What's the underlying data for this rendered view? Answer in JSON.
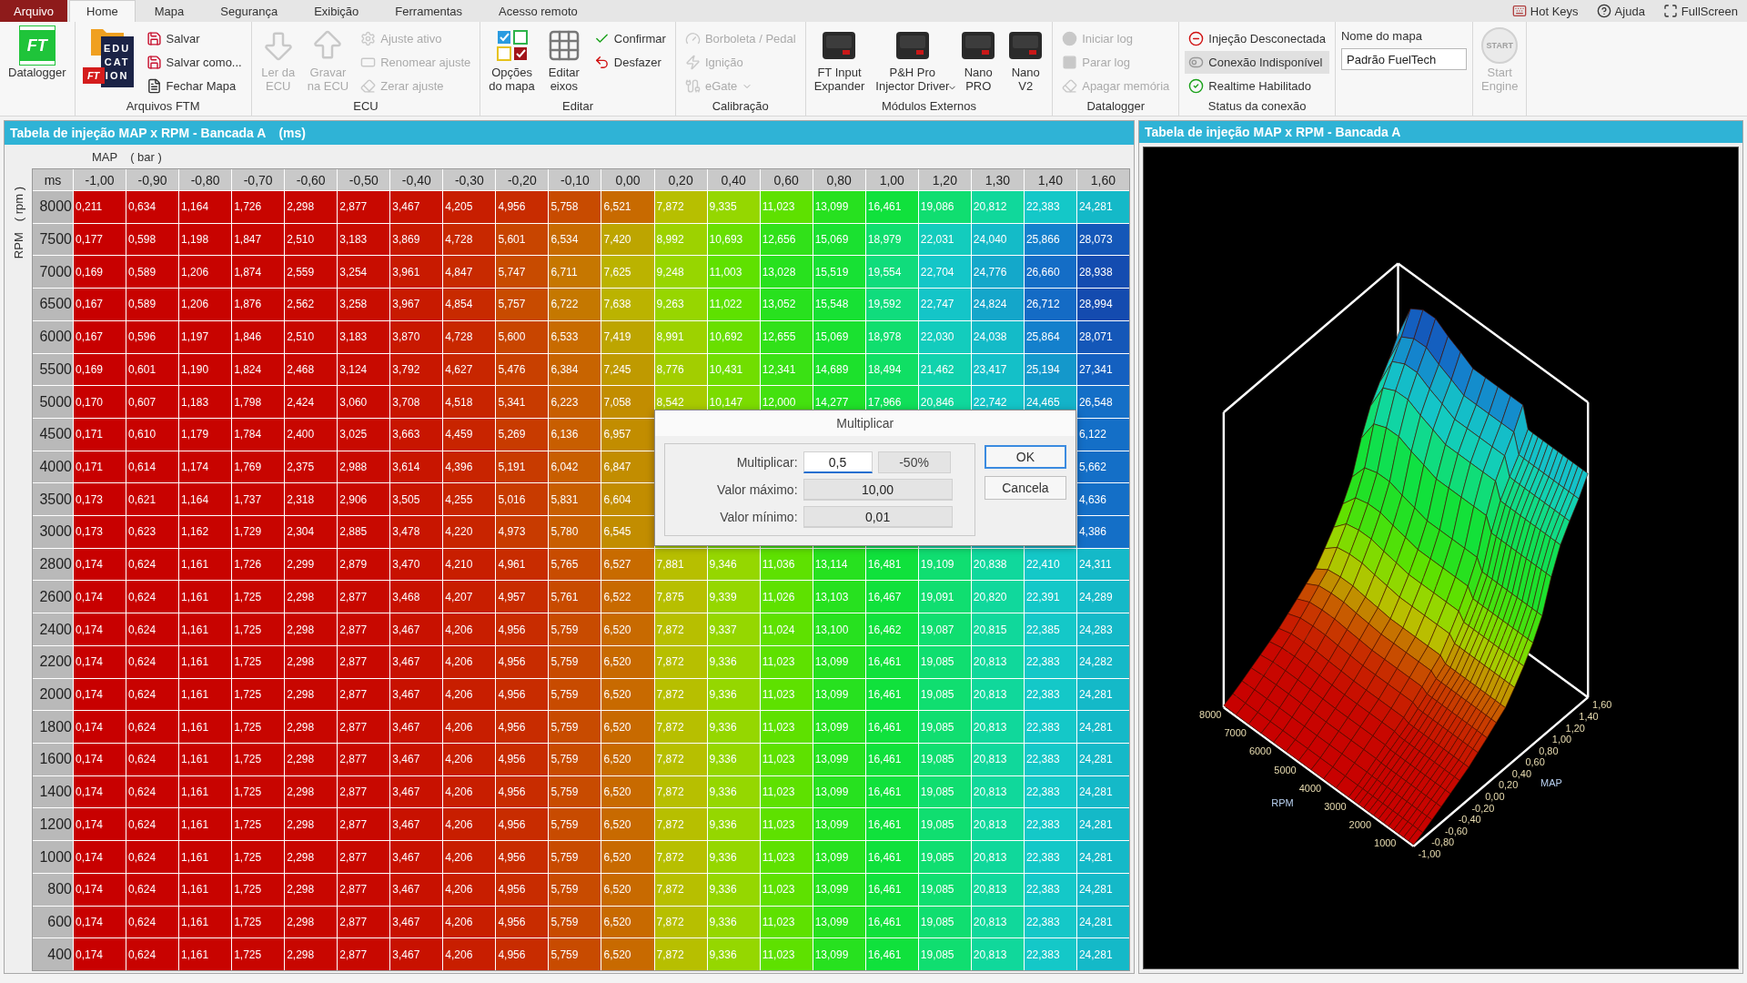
{
  "menu_tabs": [
    {
      "label": "Arquivo",
      "kind": "file",
      "selected": false
    },
    {
      "label": "Home",
      "kind": "tab",
      "selected": true
    },
    {
      "label": "Mapa",
      "kind": "tab",
      "selected": false
    },
    {
      "label": "Segurança",
      "kind": "tab",
      "selected": false
    },
    {
      "label": "Exibição",
      "kind": "tab",
      "selected": false
    },
    {
      "label": "Ferramentas",
      "kind": "tab",
      "selected": false
    },
    {
      "label": "Acesso remoto",
      "kind": "tab",
      "selected": false
    }
  ],
  "top_links": [
    "Hot Keys",
    "Ajuda",
    "FullScreen"
  ],
  "ribbon": [
    {
      "items": [
        {
          "kind": "large",
          "label": "Datalogger",
          "badge": "FT",
          "disabled": false
        }
      ]
    },
    {
      "label": "Arquivos FTM",
      "items": [
        {
          "kind": "logo",
          "logo_text": [
            "EDU",
            "CAT",
            "ION"
          ],
          "badge": "FT"
        },
        {
          "kind": "small",
          "label": "Salvar",
          "disabled": false
        },
        {
          "kind": "small",
          "label": "Salvar como...",
          "disabled": false
        },
        {
          "kind": "small",
          "label": "Fechar Mapa",
          "disabled": false
        }
      ]
    },
    {
      "label": "ECU",
      "items": [
        {
          "kind": "large",
          "label": "Ler da\nECU",
          "disabled": true
        },
        {
          "kind": "large",
          "label": "Gravar\nna ECU",
          "disabled": true
        },
        {
          "kind": "small",
          "label": "Ajuste ativo",
          "disabled": true
        },
        {
          "kind": "small",
          "label": "Renomear ajuste",
          "disabled": true
        },
        {
          "kind": "small",
          "label": "Zerar ajuste",
          "disabled": true
        }
      ]
    },
    {
      "label": "Editar",
      "items": [
        {
          "kind": "large",
          "label": "Opções\ndo mapa",
          "disabled": false
        },
        {
          "kind": "large",
          "label": "Editar\neixos",
          "disabled": false
        },
        {
          "kind": "small",
          "label": "Confirmar",
          "disabled": false
        },
        {
          "kind": "small",
          "label": "Desfazer",
          "disabled": false
        }
      ]
    },
    {
      "label": "Calibração",
      "items": [
        {
          "kind": "small",
          "label": "Borboleta / Pedal",
          "disabled": true
        },
        {
          "kind": "small",
          "label": "Ignição",
          "disabled": true
        },
        {
          "kind": "small",
          "label": "eGate",
          "disabled": true,
          "dropdown": true
        }
      ]
    },
    {
      "label": "Módulos Externos",
      "items": [
        {
          "kind": "large",
          "label": "FT Input\nExpander",
          "disabled": false
        },
        {
          "kind": "large",
          "label": "P&H Pro\nInjector Driver",
          "disabled": false,
          "dropdown": true
        },
        {
          "kind": "large",
          "label": "Nano\nPRO",
          "disabled": false
        },
        {
          "kind": "large",
          "label": "Nano\nV2",
          "disabled": false
        }
      ]
    },
    {
      "label": "Datalogger",
      "items": [
        {
          "kind": "small",
          "label": "Iniciar log",
          "disabled": true
        },
        {
          "kind": "small",
          "label": "Parar log",
          "disabled": true
        },
        {
          "kind": "small",
          "label": "Apagar memória",
          "disabled": true
        }
      ]
    },
    {
      "label": "Status da conexão",
      "items": [
        {
          "kind": "status",
          "label": "Injeção Desconectada",
          "highlighted": false
        },
        {
          "kind": "status",
          "label": "Conexão Indisponível",
          "highlighted": true
        },
        {
          "kind": "status",
          "label": "Realtime Habilitado",
          "highlighted": false
        }
      ]
    },
    {
      "items": [
        {
          "kind": "field",
          "label": "Nome do mapa",
          "value": "Padrão FuelTech"
        }
      ]
    },
    {
      "items": [
        {
          "kind": "large",
          "label": "Start\nEngine",
          "badge": "START",
          "disabled": true
        }
      ]
    }
  ],
  "table_panel": {
    "title": "Tabela de injeção MAP x RPM - Bancada A",
    "unit": "(ms)",
    "x_axis": "MAP",
    "x_unit": "( bar )",
    "y_axis": "RPM",
    "y_unit": "( rpm )",
    "corner": "ms",
    "columns": [
      "-1,00",
      "-0,90",
      "-0,80",
      "-0,70",
      "-0,60",
      "-0,50",
      "-0,40",
      "-0,30",
      "-0,20",
      "-0,10",
      "0,00",
      "0,20",
      "0,40",
      "0,60",
      "0,80",
      "1,00",
      "1,20",
      "1,30",
      "1,40",
      "1,60"
    ],
    "rows": [
      {
        "rpm": "8000",
        "cells": [
          "0,211",
          "0,634",
          "1,164",
          "1,726",
          "2,298",
          "2,877",
          "3,467",
          "4,205",
          "4,956",
          "5,758",
          "6,521",
          "7,872",
          "9,335",
          "11,023",
          "13,099",
          "16,461",
          "19,086",
          "20,812",
          "22,383",
          "24,281"
        ]
      },
      {
        "rpm": "7500",
        "cells": [
          "0,177",
          "0,598",
          "1,198",
          "1,847",
          "2,510",
          "3,183",
          "3,869",
          "4,728",
          "5,601",
          "6,534",
          "7,420",
          "8,992",
          "10,693",
          "12,656",
          "15,069",
          "18,979",
          "22,031",
          "24,040",
          "25,866",
          "28,073"
        ]
      },
      {
        "rpm": "7000",
        "cells": [
          "0,169",
          "0,589",
          "1,206",
          "1,874",
          "2,559",
          "3,254",
          "3,961",
          "4,847",
          "5,747",
          "6,711",
          "7,625",
          "9,248",
          "11,003",
          "13,028",
          "15,519",
          "19,554",
          "22,704",
          "24,776",
          "26,660",
          "28,938"
        ]
      },
      {
        "rpm": "6500",
        "cells": [
          "0,167",
          "0,589",
          "1,206",
          "1,876",
          "2,562",
          "3,258",
          "3,967",
          "4,854",
          "5,757",
          "6,722",
          "7,638",
          "9,263",
          "11,022",
          "13,052",
          "15,548",
          "19,592",
          "22,747",
          "24,824",
          "26,712",
          "28,994"
        ]
      },
      {
        "rpm": "6000",
        "cells": [
          "0,167",
          "0,596",
          "1,197",
          "1,846",
          "2,510",
          "3,183",
          "3,870",
          "4,728",
          "5,600",
          "6,533",
          "7,419",
          "8,991",
          "10,692",
          "12,655",
          "15,069",
          "18,978",
          "22,030",
          "24,038",
          "25,864",
          "28,071"
        ]
      },
      {
        "rpm": "5500",
        "cells": [
          "0,169",
          "0,601",
          "1,190",
          "1,824",
          "2,468",
          "3,124",
          "3,792",
          "4,627",
          "5,476",
          "6,384",
          "7,245",
          "8,776",
          "10,431",
          "12,341",
          "14,689",
          "18,494",
          "21,462",
          "23,417",
          "25,194",
          "27,341"
        ]
      },
      {
        "rpm": "5000",
        "cells": [
          "0,170",
          "0,607",
          "1,183",
          "1,798",
          "2,424",
          "3,060",
          "3,708",
          "4,518",
          "5,341",
          "6,223",
          "7,058",
          "8,542",
          "10,147",
          "12,000",
          "14,277",
          "17,966",
          "20,846",
          "22,742",
          "24,465",
          "26,548"
        ]
      },
      {
        "rpm": "4500",
        "cells": [
          "0,171",
          "0,610",
          "1,179",
          "1,784",
          "2,400",
          "3,025",
          "3,663",
          "4,459",
          "5,269",
          "6,136",
          "6,957",
          null,
          null,
          null,
          null,
          null,
          null,
          null,
          null,
          "6,122"
        ]
      },
      {
        "rpm": "4000",
        "cells": [
          "0,171",
          "0,614",
          "1,174",
          "1,769",
          "2,375",
          "2,988",
          "3,614",
          "4,396",
          "5,191",
          "6,042",
          "6,847",
          null,
          null,
          null,
          null,
          null,
          null,
          null,
          null,
          "5,662"
        ]
      },
      {
        "rpm": "3500",
        "cells": [
          "0,173",
          "0,621",
          "1,164",
          "1,737",
          "2,318",
          "2,906",
          "3,505",
          "4,255",
          "5,016",
          "5,831",
          "6,604",
          null,
          null,
          null,
          null,
          null,
          null,
          null,
          null,
          "4,636"
        ]
      },
      {
        "rpm": "3000",
        "cells": [
          "0,173",
          "0,623",
          "1,162",
          "1,729",
          "2,304",
          "2,885",
          "3,478",
          "4,220",
          "4,973",
          "5,780",
          "6,545",
          null,
          null,
          null,
          null,
          null,
          null,
          null,
          null,
          "4,386"
        ]
      },
      {
        "rpm": "2800",
        "cells": [
          "0,174",
          "0,624",
          "1,161",
          "1,726",
          "2,299",
          "2,879",
          "3,470",
          "4,210",
          "4,961",
          "5,765",
          "6,527",
          "7,881",
          "9,346",
          "11,036",
          "13,114",
          "16,481",
          "19,109",
          "20,838",
          "22,410",
          "24,311"
        ]
      },
      {
        "rpm": "2600",
        "cells": [
          "0,174",
          "0,624",
          "1,161",
          "1,725",
          "2,298",
          "2,877",
          "3,468",
          "4,207",
          "4,957",
          "5,761",
          "6,522",
          "7,875",
          "9,339",
          "11,026",
          "13,103",
          "16,467",
          "19,091",
          "20,820",
          "22,391",
          "24,289"
        ]
      },
      {
        "rpm": "2400",
        "cells": [
          "0,174",
          "0,624",
          "1,161",
          "1,725",
          "2,298",
          "2,877",
          "3,467",
          "4,206",
          "4,956",
          "5,759",
          "6,520",
          "7,872",
          "9,337",
          "11,024",
          "13,100",
          "16,462",
          "19,087",
          "20,815",
          "22,385",
          "24,283"
        ]
      },
      {
        "rpm": "2200",
        "cells": [
          "0,174",
          "0,624",
          "1,161",
          "1,725",
          "2,298",
          "2,877",
          "3,467",
          "4,206",
          "4,956",
          "5,759",
          "6,520",
          "7,872",
          "9,336",
          "11,023",
          "13,099",
          "16,461",
          "19,085",
          "20,813",
          "22,383",
          "24,282"
        ]
      },
      {
        "rpm": "2000",
        "cells": [
          "0,174",
          "0,624",
          "1,161",
          "1,725",
          "2,298",
          "2,877",
          "3,467",
          "4,206",
          "4,956",
          "5,759",
          "6,520",
          "7,872",
          "9,336",
          "11,023",
          "13,099",
          "16,461",
          "19,085",
          "20,813",
          "22,383",
          "24,281"
        ]
      },
      {
        "rpm": "1800",
        "cells": [
          "0,174",
          "0,624",
          "1,161",
          "1,725",
          "2,298",
          "2,877",
          "3,467",
          "4,206",
          "4,956",
          "5,759",
          "6,520",
          "7,872",
          "9,336",
          "11,023",
          "13,099",
          "16,461",
          "19,085",
          "20,813",
          "22,383",
          "24,281"
        ]
      },
      {
        "rpm": "1600",
        "cells": [
          "0,174",
          "0,624",
          "1,161",
          "1,725",
          "2,298",
          "2,877",
          "3,467",
          "4,206",
          "4,956",
          "5,759",
          "6,520",
          "7,872",
          "9,336",
          "11,023",
          "13,099",
          "16,461",
          "19,085",
          "20,813",
          "22,383",
          "24,281"
        ]
      },
      {
        "rpm": "1400",
        "cells": [
          "0,174",
          "0,624",
          "1,161",
          "1,725",
          "2,298",
          "2,877",
          "3,467",
          "4,206",
          "4,956",
          "5,759",
          "6,520",
          "7,872",
          "9,336",
          "11,023",
          "13,099",
          "16,461",
          "19,085",
          "20,813",
          "22,383",
          "24,281"
        ]
      },
      {
        "rpm": "1200",
        "cells": [
          "0,174",
          "0,624",
          "1,161",
          "1,725",
          "2,298",
          "2,877",
          "3,467",
          "4,206",
          "4,956",
          "5,759",
          "6,520",
          "7,872",
          "9,336",
          "11,023",
          "13,099",
          "16,461",
          "19,085",
          "20,813",
          "22,383",
          "24,281"
        ]
      },
      {
        "rpm": "1000",
        "cells": [
          "0,174",
          "0,624",
          "1,161",
          "1,725",
          "2,298",
          "2,877",
          "3,467",
          "4,206",
          "4,956",
          "5,759",
          "6,520",
          "7,872",
          "9,336",
          "11,023",
          "13,099",
          "16,461",
          "19,085",
          "20,813",
          "22,383",
          "24,281"
        ]
      },
      {
        "rpm": "800",
        "cells": [
          "0,174",
          "0,624",
          "1,161",
          "1,725",
          "2,298",
          "2,877",
          "3,467",
          "4,206",
          "4,956",
          "5,759",
          "6,520",
          "7,872",
          "9,336",
          "11,023",
          "13,099",
          "16,461",
          "19,085",
          "20,813",
          "22,383",
          "24,281"
        ]
      },
      {
        "rpm": "600",
        "cells": [
          "0,174",
          "0,624",
          "1,161",
          "1,725",
          "2,298",
          "2,877",
          "3,467",
          "4,206",
          "4,956",
          "5,759",
          "6,520",
          "7,872",
          "9,336",
          "11,023",
          "13,099",
          "16,461",
          "19,085",
          "20,813",
          "22,383",
          "24,281"
        ]
      },
      {
        "rpm": "400",
        "cells": [
          "0,174",
          "0,624",
          "1,161",
          "1,725",
          "2,298",
          "2,877",
          "3,467",
          "4,206",
          "4,956",
          "5,759",
          "6,520",
          "7,872",
          "9,336",
          "11,023",
          "13,099",
          "16,461",
          "19,085",
          "20,813",
          "22,383",
          "24,281"
        ]
      }
    ]
  },
  "dialog": {
    "title": "Multiplicar",
    "fields": [
      {
        "label": "Multiplicar:",
        "value": "0,5",
        "focused": true,
        "extra": "-50%"
      },
      {
        "label": "Valor máximo:",
        "value": "10,00",
        "focused": false
      },
      {
        "label": "Valor mínimo:",
        "value": "0,01",
        "focused": false
      }
    ],
    "buttons": [
      {
        "label": "OK",
        "default": true
      },
      {
        "label": "Cancela",
        "default": false
      }
    ]
  },
  "chart_panel": {
    "title": "Tabela de injeção MAP x RPM - Bancada A",
    "rpm_title": "RPM",
    "map_title": "MAP",
    "rpm_ticks": [
      "8000",
      "7000",
      "6000",
      "5000",
      "4000",
      "3000",
      "2000",
      "1000"
    ],
    "map_ticks": [
      "-1,00",
      "-0,80",
      "-0,60",
      "-0,40",
      "-0,20",
      "0,00",
      "0,20",
      "0,40",
      "0,60",
      "0,80",
      "1,00",
      "1,20",
      "1,40",
      "1,60"
    ]
  }
}
